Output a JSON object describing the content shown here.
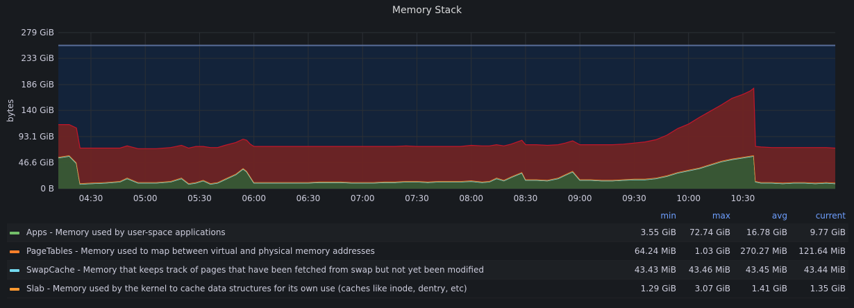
{
  "panel": {
    "title": "Memory Stack"
  },
  "chart_data": {
    "type": "area",
    "stacked": true,
    "title": "Memory Stack",
    "ylabel": "bytes",
    "xlabel": "",
    "y_ticks": [
      "0 B",
      "46.6 GiB",
      "93.1 GiB",
      "140 GiB",
      "186 GiB",
      "233 GiB",
      "279 GiB"
    ],
    "y_tick_values": [
      0,
      46.6,
      93.1,
      140,
      186,
      233,
      279
    ],
    "ylim": [
      0,
      279
    ],
    "x_ticks": [
      "04:30",
      "05:00",
      "05:30",
      "06:00",
      "06:30",
      "07:00",
      "07:30",
      "08:00",
      "08:30",
      "09:00",
      "09:30",
      "10:00",
      "10:30"
    ],
    "x_tick_minutes": [
      270,
      300,
      330,
      360,
      390,
      420,
      450,
      480,
      510,
      540,
      570,
      600,
      630
    ],
    "xlim_minutes": [
      252,
      681
    ],
    "total_line_gib": 256,
    "grid": true,
    "x": [
      252,
      258,
      262,
      264,
      270,
      278,
      286,
      290,
      296,
      300,
      306,
      314,
      320,
      324,
      328,
      332,
      336,
      340,
      344,
      350,
      354,
      356,
      358,
      360,
      366,
      372,
      378,
      384,
      390,
      396,
      402,
      408,
      414,
      420,
      426,
      432,
      438,
      444,
      450,
      456,
      462,
      468,
      474,
      480,
      486,
      490,
      494,
      498,
      502,
      508,
      510,
      516,
      522,
      528,
      532,
      536,
      540,
      546,
      552,
      558,
      564,
      570,
      576,
      582,
      588,
      594,
      600,
      606,
      612,
      618,
      624,
      630,
      634,
      636,
      637,
      640,
      646,
      652,
      658,
      664,
      670,
      676,
      681
    ],
    "series": [
      {
        "name": "Apps - Memory used by user-space applications",
        "color": "#73bf69",
        "values": [
          55,
          58,
          45,
          8,
          9,
          10,
          12,
          18,
          10,
          10,
          10,
          12,
          18,
          8,
          10,
          14,
          8,
          10,
          16,
          25,
          35,
          30,
          20,
          10,
          10,
          10,
          10,
          10,
          10,
          11,
          11,
          11,
          10,
          10,
          10,
          11,
          11,
          12,
          12,
          11,
          12,
          12,
          12,
          13,
          11,
          12,
          18,
          14,
          20,
          28,
          15,
          15,
          14,
          18,
          24,
          30,
          15,
          15,
          14,
          14,
          15,
          16,
          16,
          18,
          22,
          28,
          32,
          36,
          42,
          48,
          52,
          55,
          57,
          58,
          12,
          10,
          10,
          9,
          10,
          10,
          9,
          10,
          9
        ]
      },
      {
        "name": "PageTables - Memory used to map between virtual and physical memory addresses",
        "color": "#ff7f2a",
        "values": [
          0.12,
          0.12,
          0.12,
          0.12,
          0.12,
          0.12,
          0.12,
          0.12,
          0.12,
          0.12,
          0.12,
          0.12,
          0.12,
          0.12,
          0.12,
          0.12,
          0.12,
          0.12,
          0.12,
          0.12,
          0.12,
          0.12,
          0.12,
          0.12,
          0.12,
          0.12,
          0.12,
          0.12,
          0.12,
          0.12,
          0.12,
          0.12,
          0.12,
          0.12,
          0.12,
          0.12,
          0.12,
          0.12,
          0.12,
          0.12,
          0.12,
          0.12,
          0.12,
          0.12,
          0.12,
          0.12,
          0.12,
          0.12,
          0.12,
          0.12,
          0.12,
          0.12,
          0.12,
          0.12,
          0.12,
          0.12,
          0.12,
          0.12,
          0.12,
          0.12,
          0.12,
          0.12,
          0.12,
          0.12,
          0.12,
          0.12,
          0.12,
          0.12,
          0.12,
          0.12,
          0.12,
          0.12,
          0.12,
          0.12,
          0.12,
          0.12,
          0.12,
          0.12,
          0.12,
          0.12,
          0.12,
          0.12,
          0.12
        ]
      },
      {
        "name": "SwapCache - Memory that keeps track of pages that have been fetched from swap but not yet been modified",
        "color": "#73d9ef",
        "values": [
          0.04,
          0.04,
          0.04,
          0.04,
          0.04,
          0.04,
          0.04,
          0.04,
          0.04,
          0.04,
          0.04,
          0.04,
          0.04,
          0.04,
          0.04,
          0.04,
          0.04,
          0.04,
          0.04,
          0.04,
          0.04,
          0.04,
          0.04,
          0.04,
          0.04,
          0.04,
          0.04,
          0.04,
          0.04,
          0.04,
          0.04,
          0.04,
          0.04,
          0.04,
          0.04,
          0.04,
          0.04,
          0.04,
          0.04,
          0.04,
          0.04,
          0.04,
          0.04,
          0.04,
          0.04,
          0.04,
          0.04,
          0.04,
          0.04,
          0.04,
          0.04,
          0.04,
          0.04,
          0.04,
          0.04,
          0.04,
          0.04,
          0.04,
          0.04,
          0.04,
          0.04,
          0.04,
          0.04,
          0.04,
          0.04,
          0.04,
          0.04,
          0.04,
          0.04,
          0.04,
          0.04,
          0.04,
          0.04,
          0.04,
          0.04,
          0.04,
          0.04,
          0.04,
          0.04,
          0.04,
          0.04,
          0.04,
          0.04
        ]
      },
      {
        "name": "Slab - Memory used by the kernel to cache data structures for its own use (caches like inode, dentry, etc)",
        "color": "#ff9830",
        "values": [
          1.4,
          1.4,
          1.4,
          1.4,
          1.4,
          1.4,
          1.4,
          1.4,
          1.4,
          1.4,
          1.4,
          1.4,
          1.4,
          1.4,
          1.4,
          1.4,
          1.4,
          1.4,
          1.4,
          1.4,
          1.4,
          1.4,
          1.4,
          1.4,
          1.4,
          1.4,
          1.4,
          1.4,
          1.4,
          1.4,
          1.4,
          1.4,
          1.4,
          1.4,
          1.4,
          1.4,
          1.4,
          1.4,
          1.4,
          1.4,
          1.4,
          1.4,
          1.4,
          1.4,
          1.4,
          1.4,
          1.4,
          1.4,
          1.4,
          1.4,
          1.4,
          1.4,
          1.4,
          1.4,
          1.4,
          1.4,
          1.4,
          1.4,
          1.4,
          1.4,
          1.4,
          1.4,
          1.4,
          1.4,
          1.4,
          1.4,
          1.4,
          1.4,
          1.4,
          1.4,
          1.4,
          1.4,
          1.4,
          1.4,
          1.4,
          1.4,
          1.4,
          1.4,
          1.4,
          1.4,
          1.4,
          1.4,
          1.4
        ]
      },
      {
        "color": "#c4162a",
        "values": [
          58,
          55,
          62,
          63,
          62,
          61,
          59,
          57,
          60,
          60,
          60,
          60,
          58,
          63,
          64,
          60,
          64,
          62,
          60,
          56,
          52,
          55,
          58,
          64,
          64,
          64,
          64,
          64,
          64,
          63,
          63,
          63,
          64,
          64,
          64,
          63,
          63,
          63,
          62,
          63,
          62,
          62,
          62,
          63,
          64,
          63,
          59,
          61,
          58,
          57,
          62,
          62,
          62,
          59,
          56,
          54,
          62,
          62,
          63,
          63,
          63,
          64,
          66,
          68,
          72,
          78,
          82,
          90,
          95,
          100,
          108,
          112,
          116,
          120,
          62,
          63,
          62,
          63,
          62,
          62,
          63,
          62,
          62
        ]
      }
    ]
  },
  "legend": {
    "headers": {
      "min": "min",
      "max": "max",
      "avg": "avg",
      "current": "current"
    },
    "rows": [
      {
        "name": "Apps - Memory used by user-space applications",
        "color": "#73bf69",
        "min": "3.55 GiB",
        "max": "72.74 GiB",
        "avg": "16.78 GiB",
        "current": "9.77 GiB"
      },
      {
        "name": "PageTables - Memory used to map between virtual and physical memory addresses",
        "color": "#ff7f2a",
        "min": "64.24 MiB",
        "max": "1.03 GiB",
        "avg": "270.27 MiB",
        "current": "121.64 MiB"
      },
      {
        "name": "SwapCache - Memory that keeps track of pages that have been fetched from swap but not yet been modified",
        "color": "#73d9ef",
        "min": "43.43 MiB",
        "max": "43.46 MiB",
        "avg": "43.45 MiB",
        "current": "43.44 MiB"
      },
      {
        "name": "Slab - Memory used by the kernel to cache data structures for its own use (caches like inode, dentry, etc)",
        "color": "#ff9830",
        "min": "1.29 GiB",
        "max": "3.07 GiB",
        "avg": "1.41 GiB",
        "current": "1.35 GiB"
      }
    ]
  }
}
